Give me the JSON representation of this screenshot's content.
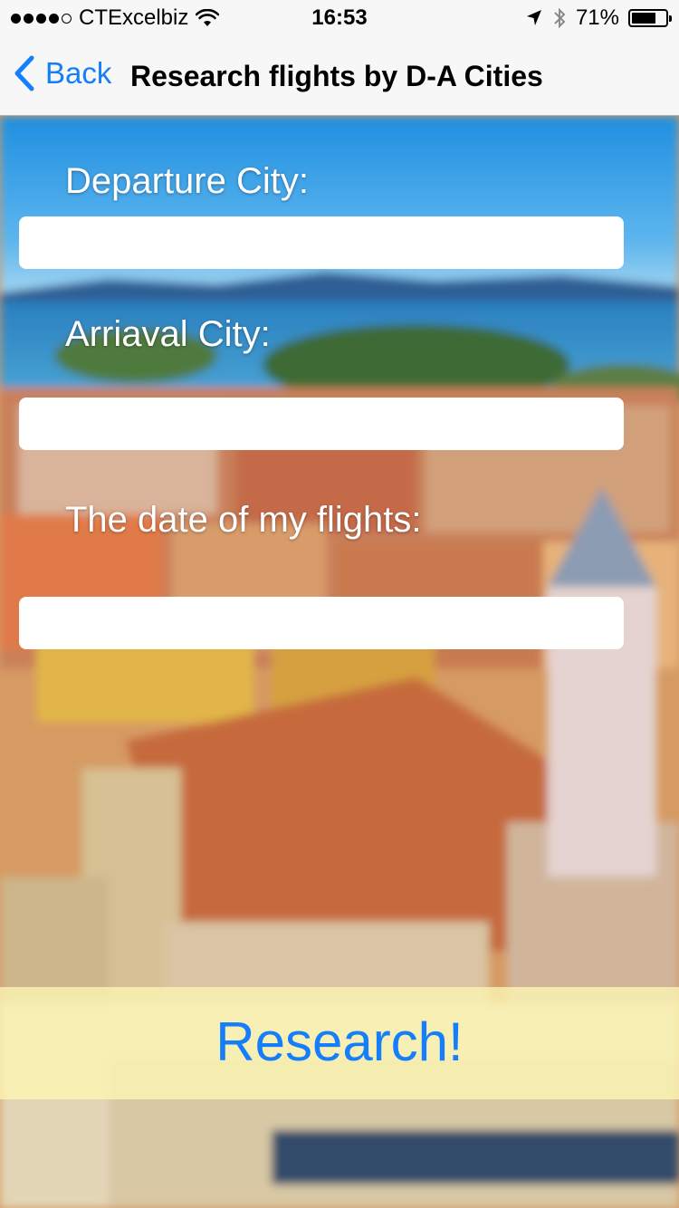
{
  "status_bar": {
    "carrier": "CTExcelbiz",
    "time": "16:53",
    "battery_percent_label": "71%",
    "battery_level": 0.71,
    "signal_bars_filled": 4,
    "signal_bars_total": 5
  },
  "nav": {
    "back_label": "Back",
    "title": "Research flights by D-A Cities"
  },
  "form": {
    "departure_label": "Departure City:",
    "departure_value": "",
    "arrival_label": "Arriaval City:",
    "arrival_value": "",
    "date_label": "The date of my flights:",
    "date_value": ""
  },
  "actions": {
    "research_label": "Research!"
  },
  "colors": {
    "accent": "#147efb",
    "bar_background": "#f7f7f7",
    "research_bar": "#fdf6b4"
  }
}
